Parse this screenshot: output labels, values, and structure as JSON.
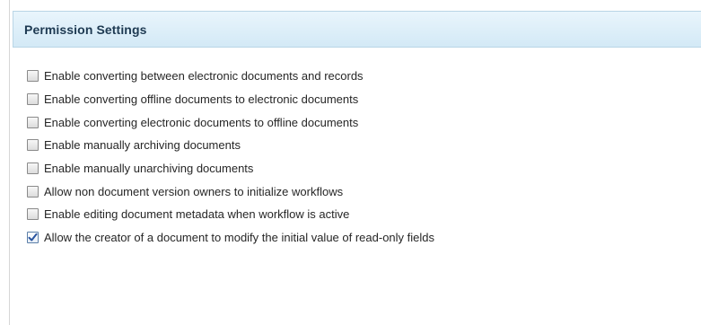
{
  "panel": {
    "title": "Permission Settings"
  },
  "options": [
    {
      "label": "Enable converting between electronic documents and records",
      "checked": false
    },
    {
      "label": "Enable converting offline documents to electronic documents",
      "checked": false
    },
    {
      "label": "Enable converting electronic documents to offline documents",
      "checked": false
    },
    {
      "label": "Enable manually archiving documents",
      "checked": false
    },
    {
      "label": "Enable manually unarchiving documents",
      "checked": false
    },
    {
      "label": "Allow non document version owners to initialize workflows",
      "checked": false
    },
    {
      "label": "Enable editing document metadata when workflow is active",
      "checked": false
    },
    {
      "label": "Allow the creator of a document to modify the initial value of read-only fields",
      "checked": true
    }
  ],
  "colors": {
    "header_bg": "#d3e9f6",
    "header_text": "#1e3a52",
    "check_mark": "#2a55a0"
  }
}
